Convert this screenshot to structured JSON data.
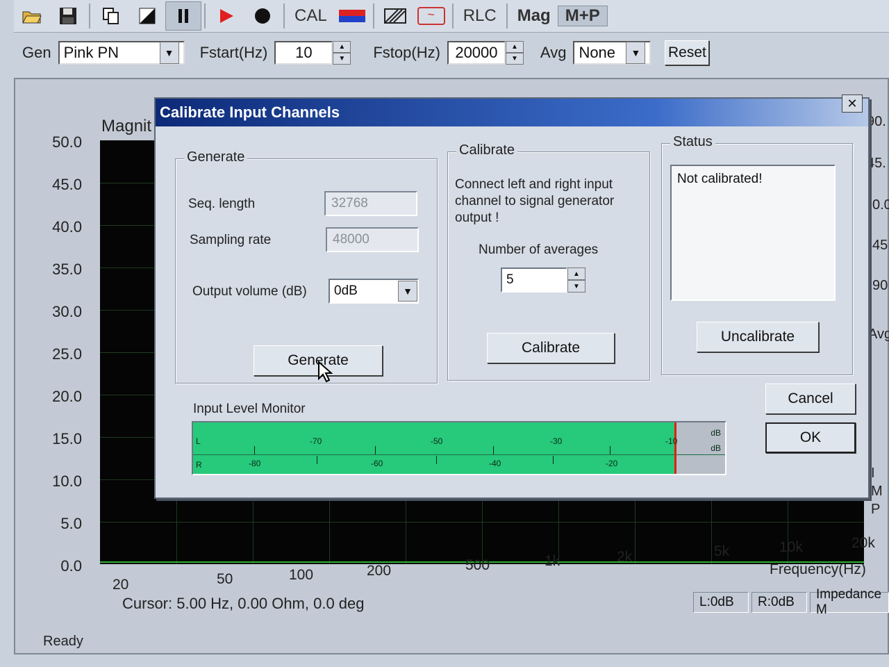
{
  "toolbar": {
    "open_icon": "folder-open-icon",
    "save_icon": "floppy-disk-icon",
    "copy_icon": "copy-icon",
    "contrast_icon": "contrast-icon",
    "pause_icon": "pause-icon",
    "play_icon": "play-icon",
    "record_icon": "record-icon",
    "cal_label": "CAL",
    "rlc_label": "RLC",
    "mag_label": "Mag",
    "mp_label": "M+P",
    "colors": {
      "play": "#e02020",
      "cal_top": "#d22222",
      "cal_bottom": "#2241c9"
    }
  },
  "controls": {
    "gen_label": "Gen",
    "gen_value": "Pink PN",
    "fstart_label": "Fstart(Hz)",
    "fstart_value": "10",
    "fstop_label": "Fstop(Hz)",
    "fstop_value": "20000",
    "avg_label": "Avg",
    "avg_value": "None",
    "reset_label": "Reset"
  },
  "plot": {
    "title_partial": "Magnit",
    "y_ticks": [
      "50.0",
      "45.0",
      "40.0",
      "35.0",
      "30.0",
      "25.0",
      "20.0",
      "15.0",
      "10.0",
      "5.0",
      "0.0"
    ],
    "x_ticks": [
      "20",
      "50",
      "100",
      "200",
      "500",
      "1k",
      "2k",
      "5k",
      "10k",
      "20k"
    ],
    "x_label": "Frequency(Hz)",
    "right_ticks": [
      "90.",
      "45.",
      "0.0",
      "45",
      "90"
    ],
    "right_avg": "Avg",
    "right_letters": [
      "I",
      "M",
      "P"
    ]
  },
  "status": {
    "cursor_text": "Cursor: 5.00 Hz, 0.00 Ohm, 0.0 deg",
    "left_level": "L:0dB",
    "right_level": "R:0dB",
    "impedance": "Impedance M",
    "ready": "Ready"
  },
  "dialog": {
    "title": "Calibrate Input Channels",
    "close_label": "✕",
    "generate_group": {
      "legend": "Generate",
      "seq_length_label": "Seq. length",
      "seq_length_value": "32768",
      "sampling_rate_label": "Sampling rate",
      "sampling_rate_value": "48000",
      "output_volume_label": "Output volume (dB)",
      "output_volume_value": "0dB",
      "generate_button": "Generate"
    },
    "calibrate_group": {
      "legend": "Calibrate",
      "instructions": [
        "Connect left and right input",
        "channel  to  signal generator",
        "output !"
      ],
      "averages_label": "Number of averages",
      "averages_value": "5",
      "calibrate_button": "Calibrate"
    },
    "status_group": {
      "legend": "Status",
      "status_text": "Not calibrated!",
      "uncalibrate_button": "Uncalibrate"
    },
    "cancel_button": "Cancel",
    "ok_button": "OK",
    "meter": {
      "label": "Input Level Monitor",
      "channel_l": "L",
      "channel_r": "R",
      "unit_top": "dB",
      "unit_bottom": "dB",
      "top_ticks": [
        "-70",
        "-50",
        "-30",
        "-10"
      ],
      "bottom_ticks": [
        "-80",
        "-60",
        "-40",
        "-20"
      ],
      "level_fraction": 0.905,
      "fill_color": "#27c97a",
      "peak_color": "#dd2211"
    }
  }
}
